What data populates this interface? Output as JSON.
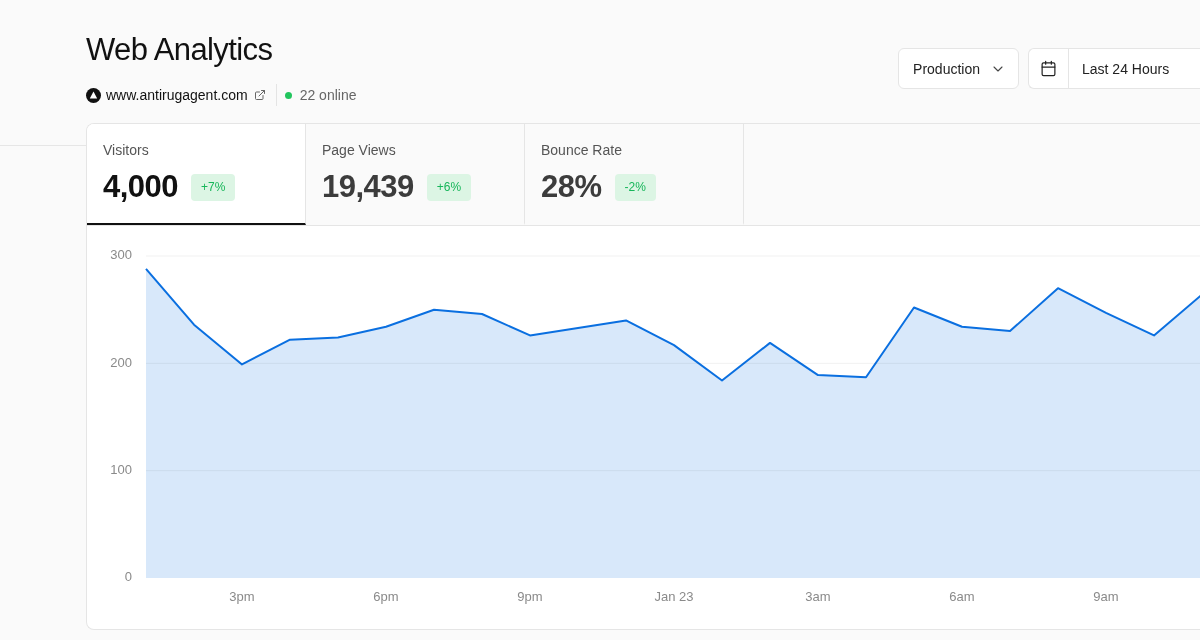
{
  "header": {
    "title": "Web Analytics",
    "site": {
      "url": "www.antirugagent.com"
    },
    "online": {
      "text": "22 online"
    }
  },
  "controls": {
    "environment": {
      "value": "Production"
    },
    "date_range": {
      "value": "Last 24 Hours"
    }
  },
  "metrics": [
    {
      "label": "Visitors",
      "value": "4,000",
      "change": "+7%",
      "selected": true
    },
    {
      "label": "Page Views",
      "value": "19,439",
      "change": "+6%",
      "selected": false
    },
    {
      "label": "Bounce Rate",
      "value": "28%",
      "change": "-2%",
      "selected": false
    }
  ],
  "chart": {
    "chart_data": {
      "type": "area",
      "categories": [
        null,
        null,
        "3pm",
        null,
        null,
        "6pm",
        null,
        null,
        "9pm",
        null,
        null,
        "Jan 23",
        null,
        null,
        "3am",
        null,
        null,
        "6am",
        null,
        null,
        "9am",
        null,
        null
      ],
      "ylim": [
        0,
        300
      ],
      "yticks": [
        0,
        100,
        200,
        300
      ],
      "series": [
        {
          "color": "#0a6fe0",
          "values": [
            288,
            236,
            199,
            222,
            224,
            234,
            250,
            246,
            226,
            233,
            240,
            217,
            184,
            219,
            189,
            187,
            252,
            234,
            230,
            270,
            247,
            226,
            264
          ]
        }
      ]
    }
  }
}
